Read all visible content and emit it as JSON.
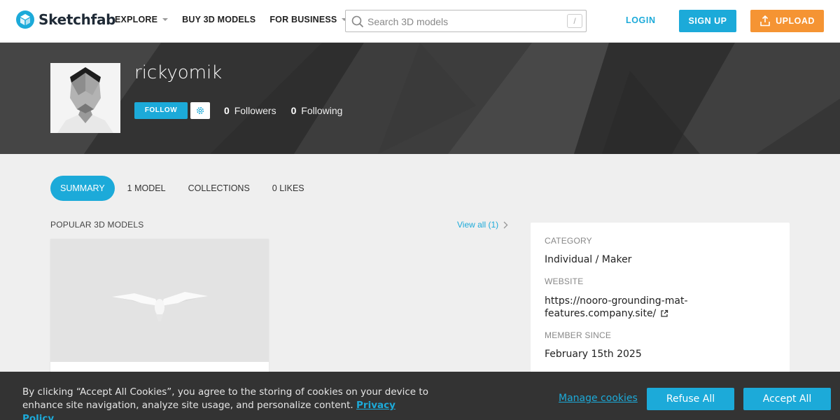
{
  "header": {
    "logo_text": "Sketchfab",
    "nav": [
      {
        "label": "EXPLORE",
        "dropdown": true
      },
      {
        "label": "BUY 3D MODELS",
        "dropdown": false
      },
      {
        "label": "FOR BUSINESS",
        "dropdown": true
      }
    ],
    "search": {
      "placeholder": "Search 3D models",
      "shortcut": "/"
    },
    "login_label": "LOGIN",
    "signup_label": "SIGN UP",
    "upload_label": "UPLOAD"
  },
  "profile": {
    "username": "rickyomik",
    "follow_label": "FOLLOW",
    "followers_count": "0",
    "followers_label": "Followers",
    "following_count": "0",
    "following_label": "Following"
  },
  "tabs": [
    {
      "label": "SUMMARY",
      "active": true
    },
    {
      "label": "1 MODEL",
      "active": false
    },
    {
      "label": "COLLECTIONS",
      "active": false
    },
    {
      "label": "0 LIKES",
      "active": false
    }
  ],
  "popular": {
    "title": "POPULAR 3D MODELS",
    "view_all": "View all (1)"
  },
  "info": {
    "category_label": "CATEGORY",
    "category_value": "Individual / Maker",
    "website_label": "WEBSITE",
    "website_value": "https://nooro-grounding-mat-features.company.site/",
    "member_label": "MEMBER SINCE",
    "member_value": "February 15th 2025"
  },
  "cookie": {
    "text": "By clicking “Accept All Cookies”, you agree to the storing of cookies on your device to enhance site navigation, analyze site usage, and personalize content.",
    "privacy_label": "Privacy Policy",
    "manage_label": "Manage cookies",
    "refuse_label": "Refuse All",
    "accept_label": "Accept All"
  },
  "colors": {
    "accent": "#1caad9",
    "upload": "#f59433",
    "banner": "#3a3a3a",
    "cookie_bar": "#333333"
  },
  "icons": [
    "sketchfab-logo-icon",
    "caret-down-icon",
    "search-icon",
    "upload-icon",
    "gear-icon",
    "chevron-right-icon",
    "external-link-icon"
  ]
}
